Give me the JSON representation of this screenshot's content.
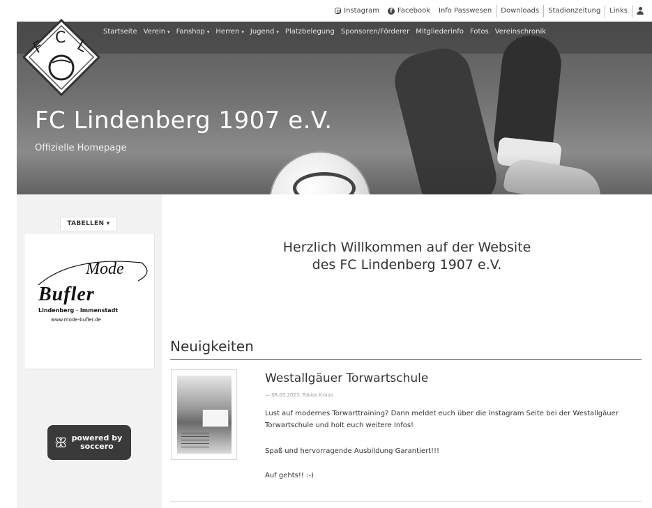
{
  "topbar": {
    "links": [
      {
        "label": "Instagram",
        "icon": "instagram-icon"
      },
      {
        "label": "Facebook",
        "icon": "facebook-icon"
      },
      {
        "label": "Info Passwesen"
      },
      {
        "label": "Downloads"
      },
      {
        "label": "Stadionzeitung"
      },
      {
        "label": "Links"
      }
    ],
    "user_icon": "user-icon"
  },
  "nav": {
    "items": [
      {
        "label": "Startseite",
        "dropdown": false
      },
      {
        "label": "Verein",
        "dropdown": true
      },
      {
        "label": "Fanshop",
        "dropdown": true
      },
      {
        "label": "Herren",
        "dropdown": true
      },
      {
        "label": "Jugend",
        "dropdown": true
      },
      {
        "label": "Platzbelegung",
        "dropdown": false
      },
      {
        "label": "Sponsoren/Förderer",
        "dropdown": false
      },
      {
        "label": "Mitgliederinfo",
        "dropdown": false
      },
      {
        "label": "Fotos",
        "dropdown": false
      },
      {
        "label": "Vereinschronik",
        "dropdown": false
      }
    ],
    "caret": "▾"
  },
  "logo": {
    "text": "FCL"
  },
  "hero": {
    "title": "FC Lindenberg 1907 e.V.",
    "subtitle": "Offizielle Homepage"
  },
  "sidebar": {
    "tabellen_label": "TABELLEN",
    "caret": "▾",
    "ad": {
      "brand_top": "Mode",
      "brand_main": "Bufler",
      "line1": "Lindenberg · Immenstadt",
      "line2": "www.mode-bufler.de"
    },
    "powered": {
      "line1": "powered by",
      "line2": "soccero"
    }
  },
  "main": {
    "welcome_line1": "Herzlich Willkommen auf der Website",
    "welcome_line2": "des FC Lindenberg 1907 e.V.",
    "news_heading": "Neuigkeiten",
    "article": {
      "title": "Westallgäuer Torwartschule",
      "meta": "— 08.03.2023, Tobias Kraus",
      "p1": "Lust auf modernes Torwarttraining? Dann meldet euch über die Instagram Seite bei der Westallgäuer Torwartschule und holt euch weitere Infos!",
      "p2": "Spaß und hervorragende Ausbildung Garantiert!!!",
      "p3": "Auf gehts!! :-)"
    }
  },
  "colors": {
    "hero_overlay": "#5b5b5b",
    "sidebar_bg": "#f2f2f2",
    "powered_bg": "#3a3a3a"
  }
}
